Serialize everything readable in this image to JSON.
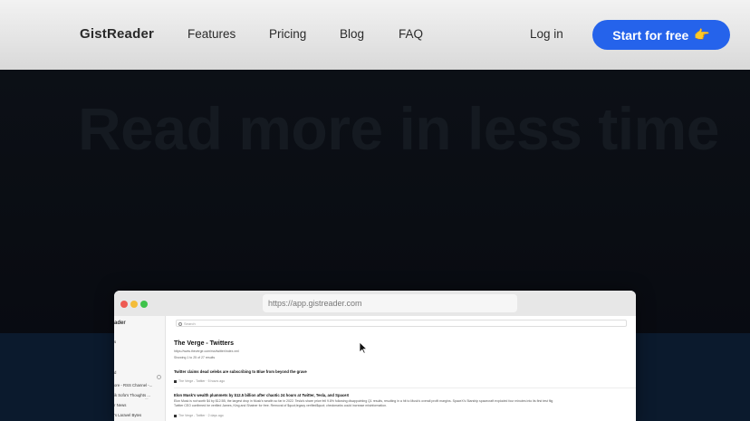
{
  "nav": {
    "logo": "GistReader",
    "links": [
      "Features",
      "Pricing",
      "Blog",
      "FAQ"
    ],
    "login": "Log in",
    "cta_label": "Start for free",
    "cta_emoji": "👉"
  },
  "hero": {
    "title": "Read more in less time"
  },
  "browser": {
    "url": "https://app.gistreader.com",
    "sidebar": {
      "brand": "ader",
      "items": [
        "s",
        "",
        "d",
        "ore - RSS Channel -...",
        "ik Sofa's Thoughts ...",
        "r News",
        "'s Laravel Bytes"
      ]
    },
    "search_placeholder": "Search",
    "feed": {
      "title": "The Verge - Twitters",
      "url": "https://www.theverge.com/rss/twitter/index.xml",
      "count": "Showing 1 to 25 of 27 results",
      "articles": [
        {
          "title": "Twitter claims dead celebs are subscribing to Blue from beyond the grave",
          "meta": "The Verge - Twitter · 5 hours ago",
          "body": ""
        },
        {
          "title": "Elon Musk's wealth plummets by $12.5 billion after chaotic 24 hours at Twitter, Tesla, and SpaceX",
          "meta": "The Verge - Twitter · 2 days ago",
          "body": "Elon Musk is not worth $4 by $12.5B, the largest drop in Musk's wealth so far in 2022. Tesla's share price fell 9.8% following disappointing Q1 results, resulting in a hit to Musk's overall profit margins. SpaceX's Starship spacecraft exploded four minutes into its first test flig",
          "body2": "Twitter CEO confirmed he verified James, King and Shatner for free. Removal of $quot;legacy verified$quot; checkmarks could increase misinformation."
        }
      ]
    }
  },
  "colors": {
    "cta": "#2563eb",
    "hero_bg": "#0d1118",
    "band": "#0b1a2d"
  }
}
